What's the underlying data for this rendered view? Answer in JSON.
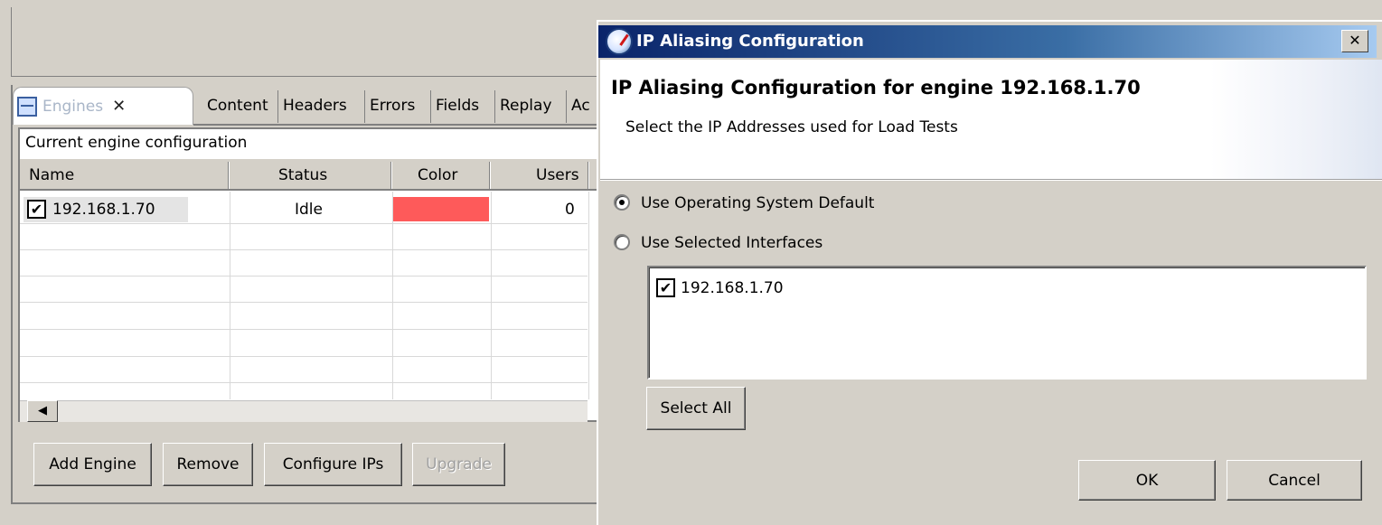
{
  "left_view": {
    "tabs": [
      {
        "label": "Engines",
        "close": "✕"
      },
      {
        "label": "Content"
      },
      {
        "label": "Headers"
      },
      {
        "label": "Errors"
      },
      {
        "label": "Fields"
      },
      {
        "label": "Replay"
      },
      {
        "label": "Ac"
      }
    ],
    "section_label": "Current engine configuration",
    "table": {
      "columns": [
        "Name",
        "Status",
        "Color",
        "Users"
      ],
      "rows": [
        {
          "name": "192.168.1.70",
          "checked": true,
          "status": "Idle",
          "color": "#fe5a5a",
          "users": "0"
        }
      ]
    },
    "buttons": {
      "add_engine": "Add Engine",
      "remove": "Remove",
      "configure_ips": "Configure IPs",
      "upgrade": "Upgrade"
    }
  },
  "dialog": {
    "title": "IP Aliasing Configuration",
    "close_glyph": "✕",
    "heading": "IP Aliasing Configuration for engine 192.168.1.70",
    "subheading": "Select the IP Addresses used for Load Tests",
    "options": {
      "default": {
        "label": "Use Operating System Default",
        "selected": true
      },
      "selected": {
        "label": "Use Selected Interfaces",
        "selected": false
      }
    },
    "interfaces": [
      {
        "label": "192.168.1.70",
        "checked": true
      }
    ],
    "buttons": {
      "select_all": "Select All",
      "ok": "OK",
      "cancel": "Cancel"
    }
  },
  "check_glyph": "✔",
  "colors": {
    "window_bg": "#d4d0c8",
    "title_start": "#0a246a",
    "title_end": "#a6caf0",
    "engine_color": "#fe5a5a"
  }
}
